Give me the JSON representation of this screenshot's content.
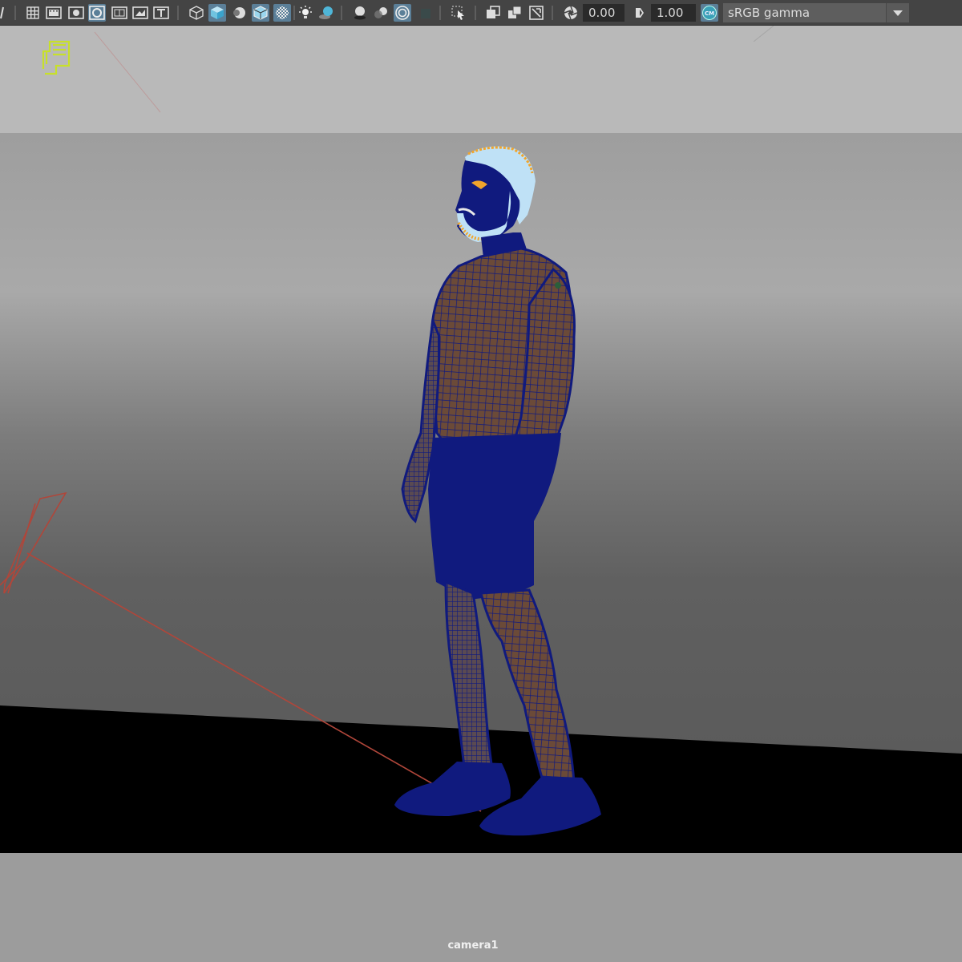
{
  "toolbar": {
    "icons": [
      "select-lasso-icon",
      "grid-icon",
      "film-gate-icon",
      "resolution-gate-icon",
      "gate-mask-icon",
      "field-chart-icon",
      "safe-action-icon",
      "safe-title-icon",
      "wireframe-icon",
      "smooth-shade-icon",
      "shaded-brush-icon",
      "wireframe-on-shaded-icon",
      "xray-icon",
      "lights-icon",
      "shadows-icon",
      "ambient-occlusion-icon",
      "motion-blur-icon",
      "anti-aliasing-icon",
      "depth-of-field-icon",
      "isolate-select-icon",
      "xray-joints-icon",
      "xray-active-icon",
      "camera-attributes-icon",
      "exposure-icon",
      "gamma-icon",
      "color-management-icon"
    ],
    "exposure_value": "0.00",
    "gamma_value": "1.00",
    "color_space": "sRGB gamma"
  },
  "viewport": {
    "camera_name": "camera1"
  },
  "colors": {
    "toolbar_bg": "#444444",
    "active_icon_bg": "#5b7f98",
    "mesh_blue": "#101a7e",
    "skin_brown": "#6b4a38",
    "hair_orange": "#f1a52c",
    "camera_frustum_red": "#b0463a",
    "logo_yellow": "#c8e02a"
  }
}
